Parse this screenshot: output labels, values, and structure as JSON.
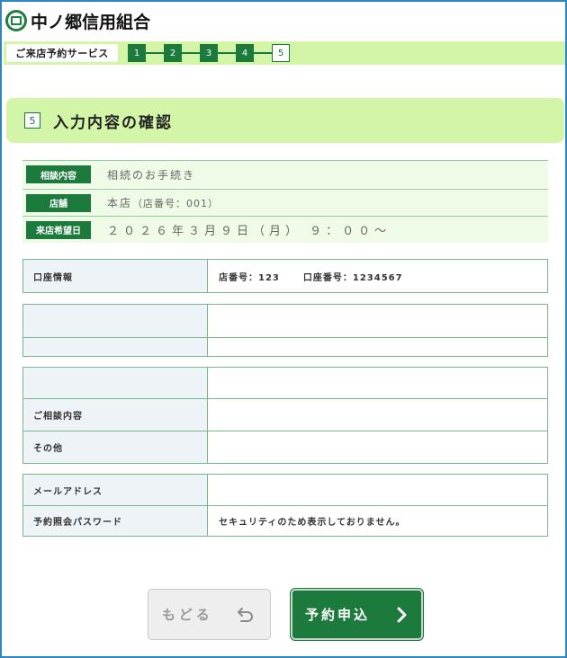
{
  "header": {
    "bank_name": "中ノ郷信用組合"
  },
  "progress": {
    "service_label": "ご来店予約サービス",
    "steps": [
      "1",
      "2",
      "3",
      "4",
      "5"
    ],
    "current_step": "5"
  },
  "section": {
    "number": "5",
    "title": "入力内容の確認"
  },
  "summary": {
    "consult_label": "相談内容",
    "consult_value": "相続のお手続き",
    "branch_label": "店舗",
    "branch_value": "本店",
    "branch_code": "（店番号：001）",
    "date_label": "来店希望日",
    "date_value": "２０２６年３月９日（月） ９：００～"
  },
  "account": {
    "label": "口座情報",
    "branch_no": "店番号：123",
    "account_no": "口座番号：1234567"
  },
  "blank_rows": {
    "row1_label": "",
    "row1_value": "",
    "row2_label": "",
    "row2_value": ""
  },
  "consult_detail": {
    "blank_label": "",
    "blank_value": "",
    "detail_label": "ご相談内容",
    "detail_value": "",
    "other_label": "その他",
    "other_value": ""
  },
  "contact": {
    "email_label": "メールアドレス",
    "email_value": "",
    "password_label": "予約照会パスワード",
    "password_value": "セキュリティのため表示しておりません。"
  },
  "buttons": {
    "back_label": "もどる",
    "submit_label": "予約申込"
  },
  "icons": {
    "logo": "bank-logo-icon",
    "back": "undo-arrow-icon",
    "submit": "chevron-right-icon"
  },
  "colors": {
    "brand_green": "#1b7a3c",
    "light_green": "#d3f5a8",
    "frame_blue": "#2e86c1"
  }
}
